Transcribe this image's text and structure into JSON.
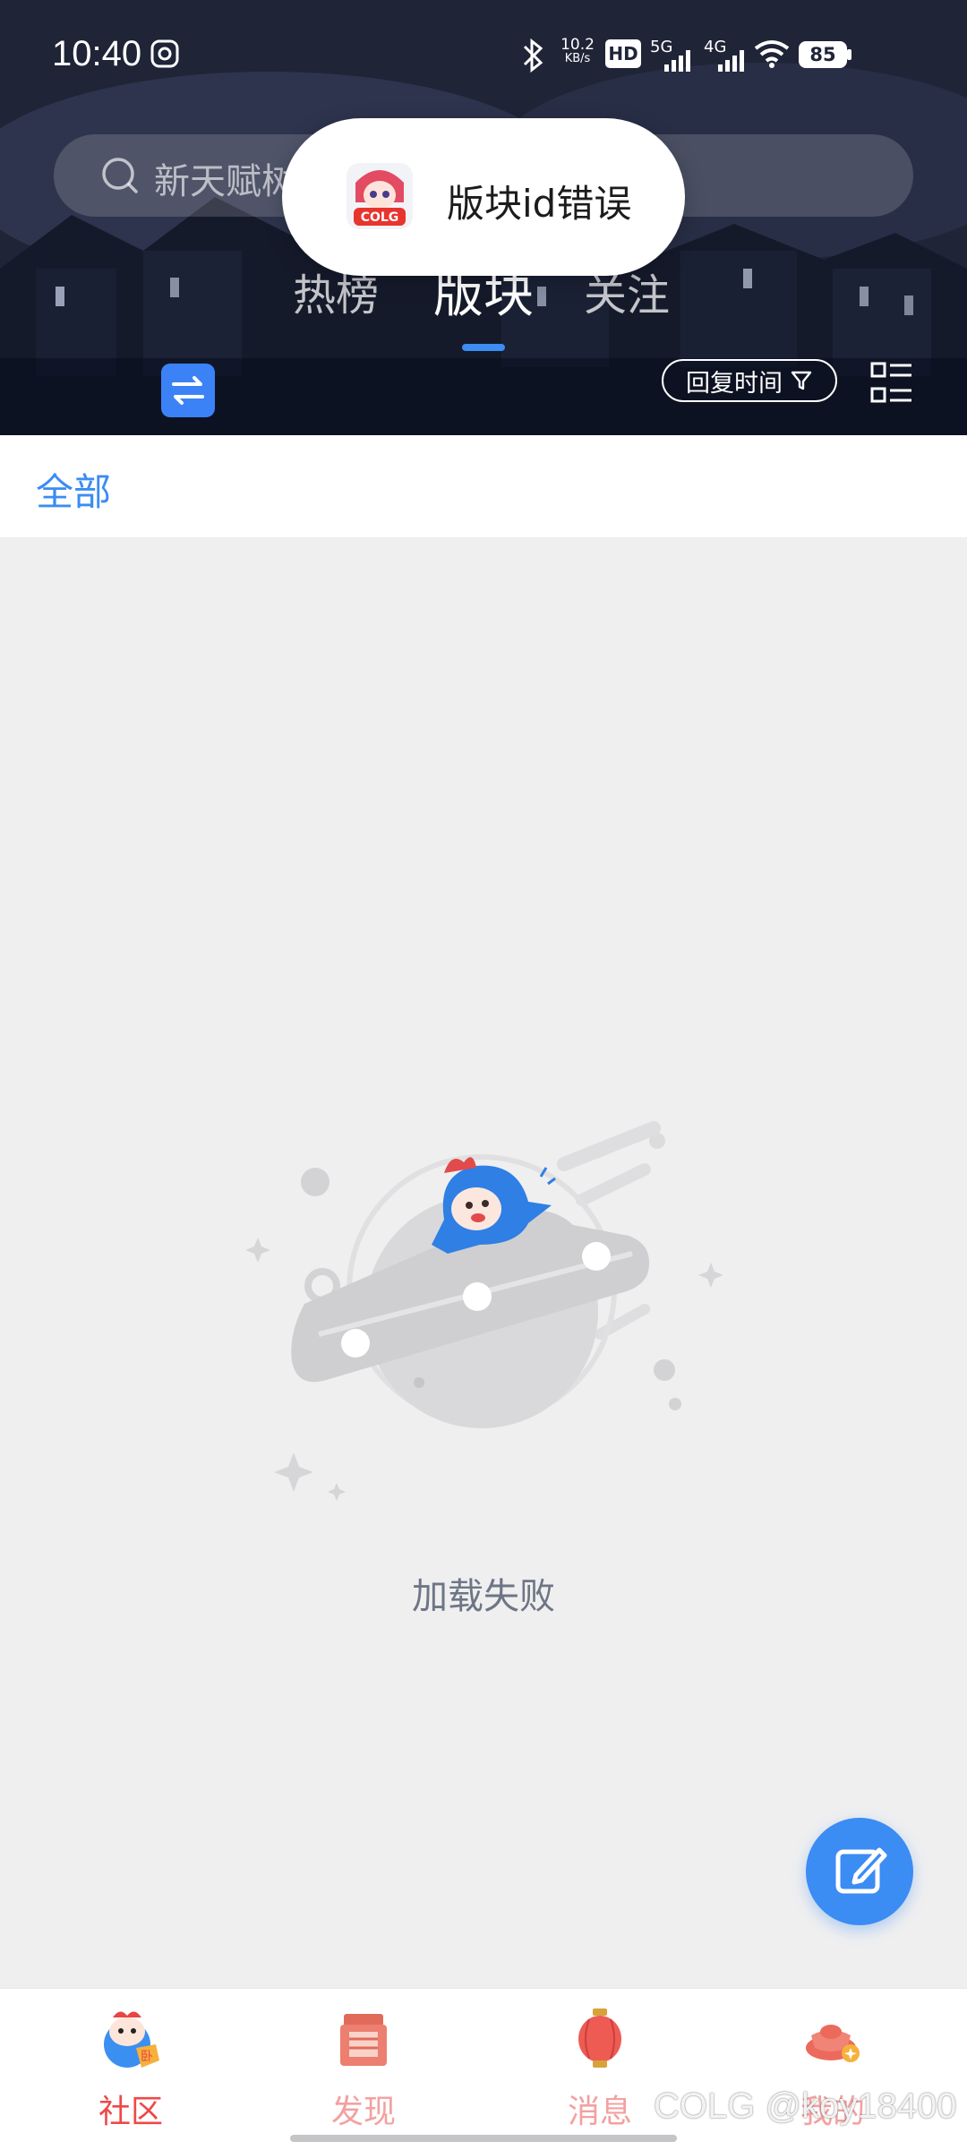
{
  "status_bar": {
    "time": "10:40",
    "net_speed_value": "10.2",
    "net_speed_unit": "KB/s",
    "hd_label": "HD",
    "signal_1": "5G",
    "signal_2": "4G",
    "battery": "85"
  },
  "search": {
    "placeholder": "新天赋树"
  },
  "tabs": [
    {
      "label": "热榜",
      "active": false
    },
    {
      "label": "版块",
      "active": true
    },
    {
      "label": "关注",
      "active": false
    }
  ],
  "toolbar": {
    "sort_label": "回复时间"
  },
  "category": {
    "label": "全部"
  },
  "empty_state": {
    "text": "加载失败"
  },
  "toast": {
    "text": "版块id错误"
  },
  "bottom_nav": [
    {
      "label": "社区",
      "active": true
    },
    {
      "label": "发现",
      "active": false
    },
    {
      "label": "消息",
      "active": false
    },
    {
      "label": "我的",
      "active": false
    }
  ],
  "watermark": "COLG @koy18400",
  "colors": {
    "accent": "#3b8cf3",
    "nav_active": "#f04848",
    "nav_inactive": "#f4a0a0"
  }
}
